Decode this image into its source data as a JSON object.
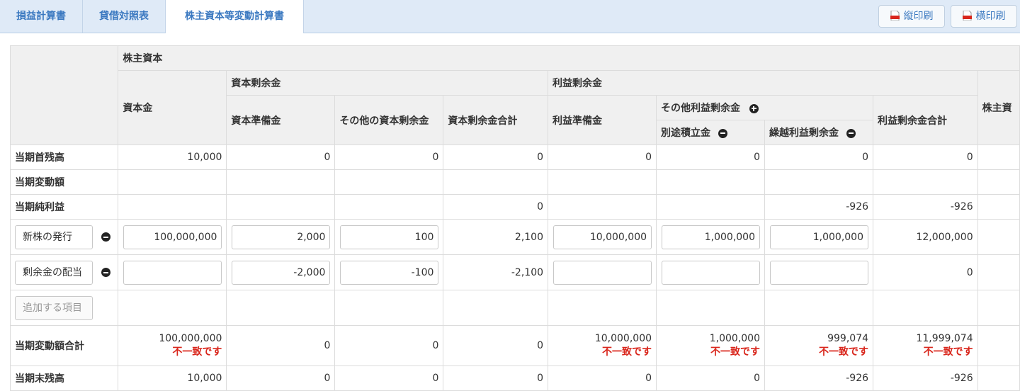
{
  "tabs": [
    {
      "label": "損益計算書"
    },
    {
      "label": "貸借対照表"
    },
    {
      "label": "株主資本等変動計算書"
    }
  ],
  "buttons": {
    "portrait": "縦印刷",
    "landscape": "横印刷"
  },
  "headers": {
    "shareholders_equity": "株主資本",
    "capital_stock": "資本金",
    "capital_surplus": "資本剰余金",
    "capital_reserve": "資本準備金",
    "other_capital_surplus": "その他の資本剰余金",
    "capital_surplus_total": "資本剰余金合計",
    "retained_earnings": "利益剰余金",
    "legal_reserve": "利益準備金",
    "other_retained_earnings": "その他利益剰余金",
    "special_reserve": "別途積立金",
    "carried_forward": "繰越利益剰余金",
    "retained_earnings_total": "利益剰余金合計",
    "shareholders_equity_total": "株主資"
  },
  "rows": {
    "opening": {
      "label": "当期首残高",
      "values": [
        "10,000",
        "0",
        "0",
        "0",
        "0",
        "0",
        "0",
        "0"
      ]
    },
    "changes": {
      "label": "当期変動額"
    },
    "net_income": {
      "label": "当期純利益",
      "values": [
        "",
        "",
        "",
        "0",
        "",
        "",
        "-926",
        "-926"
      ]
    },
    "new_shares": {
      "label": "新株の発行",
      "values": [
        "100,000,000",
        "2,000",
        "100",
        "2,100",
        "10,000,000",
        "1,000,000",
        "1,000,000",
        "12,000,000"
      ]
    },
    "dividends": {
      "label": "剰余金の配当",
      "values": [
        "",
        "-2,000",
        "-100",
        "-2,100",
        "",
        "",
        "",
        "0"
      ]
    },
    "add_item": {
      "placeholder": "追加する項目"
    },
    "total_changes": {
      "label": "当期変動額合計",
      "values": [
        "100,000,000",
        "0",
        "0",
        "0",
        "10,000,000",
        "1,000,000",
        "999,074",
        "11,999,074"
      ]
    },
    "closing": {
      "label": "当期末残高",
      "values": [
        "10,000",
        "0",
        "0",
        "0",
        "0",
        "0",
        "-926",
        "-926"
      ]
    }
  },
  "mismatch_text": "不一致です"
}
